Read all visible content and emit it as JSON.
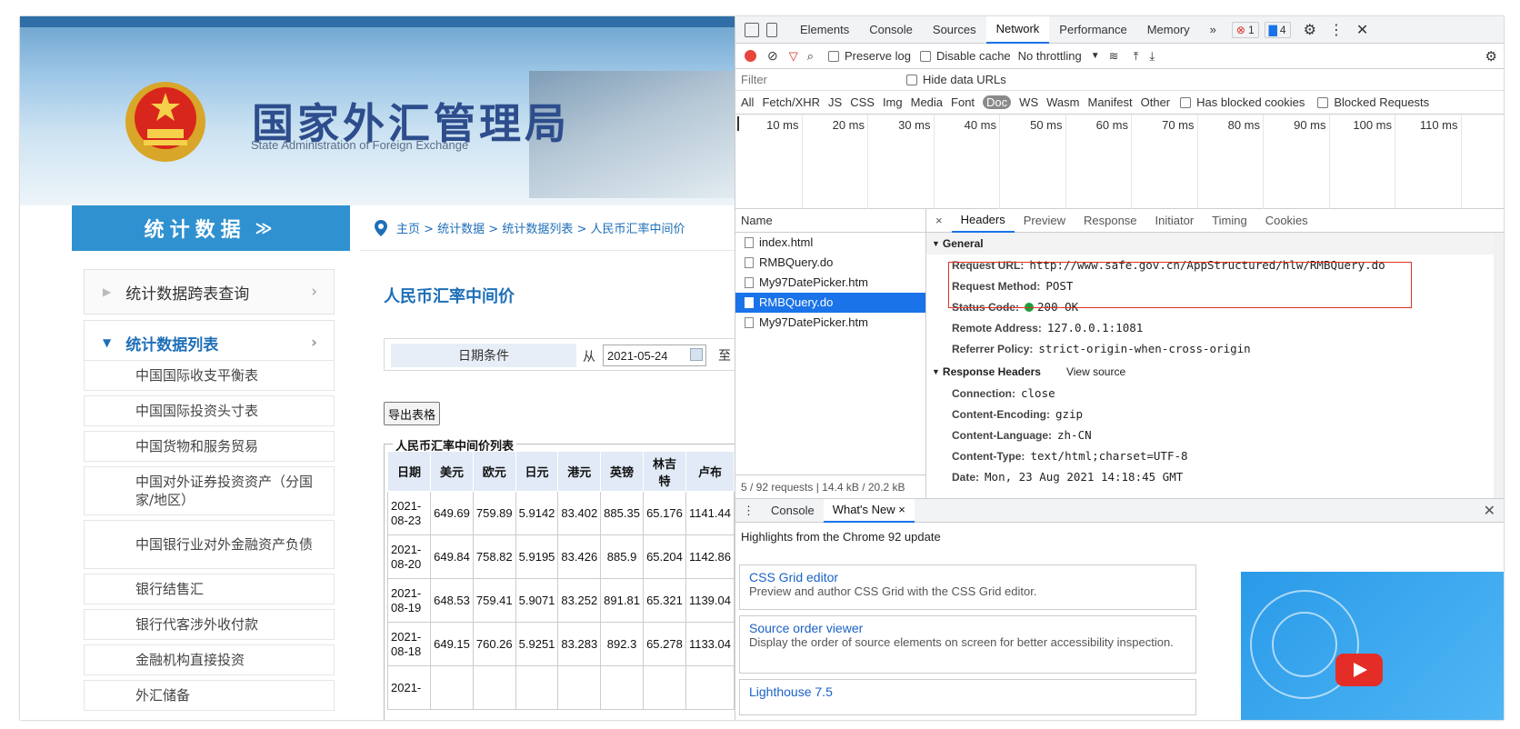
{
  "site": {
    "title": "国家外汇管理局",
    "subtitle": "State Administration of Foreign Exchange",
    "sidebar_heading": "统计数据",
    "sidebar_heading_chevron": "≫",
    "nav_items": [
      {
        "label": "统计数据跨表查询",
        "arrow": "›"
      },
      {
        "label": "统计数据列表",
        "arrow": "›"
      }
    ],
    "sub_items": [
      "中国国际收支平衡表",
      "中国国际投资头寸表",
      "中国货物和服务贸易",
      "中国对外证券投资资产（分国家/地区）",
      "中国银行业对外金融资产负债",
      "银行结售汇",
      "银行代客涉外收付款",
      "金融机构直接投资",
      "外汇储备"
    ],
    "breadcrumb": "主页 > 统计数据 > 统计数据列表 > 人民币汇率中间价",
    "page_heading": "人民币汇率中间价",
    "filter_label": "日期条件",
    "filter_from": "从",
    "filter_date": "2021-05-24",
    "filter_cut": "至",
    "export_button": "导出表格",
    "table_caption": "人民币汇率中间价列表",
    "table_headers": [
      "日期",
      "美元",
      "欧元",
      "日元",
      "港元",
      "英镑",
      "林吉特",
      "卢布"
    ],
    "rows": [
      [
        "2021-08-23",
        "649.69",
        "759.89",
        "5.9142",
        "83.402",
        "885.35",
        "65.176",
        "1141.44"
      ],
      [
        "2021-08-20",
        "649.84",
        "758.82",
        "5.9195",
        "83.426",
        "885.9",
        "65.204",
        "1142.86"
      ],
      [
        "2021-08-19",
        "648.53",
        "759.41",
        "5.9071",
        "83.252",
        "891.81",
        "65.321",
        "1139.04"
      ],
      [
        "2021-08-18",
        "649.15",
        "760.26",
        "5.9251",
        "83.283",
        "892.3",
        "65.278",
        "1133.04"
      ],
      [
        "2021-",
        "",
        "",
        "",
        "",
        "",
        "",
        ""
      ]
    ]
  },
  "devtools": {
    "tabs": [
      "Elements",
      "Console",
      "Sources",
      "Network",
      "Performance",
      "Memory",
      "»"
    ],
    "selected_tab": "Network",
    "error_count": "1",
    "message_count": "4",
    "toolbar": {
      "preserve_log": "Preserve log",
      "disable_cache": "Disable cache",
      "throttling": "No throttling"
    },
    "filter_placeholder": "Filter",
    "hide_data_urls": "Hide data URLs",
    "type_filters": [
      "All",
      "Fetch/XHR",
      "JS",
      "CSS",
      "Img",
      "Media",
      "Font",
      "Doc",
      "WS",
      "Wasm",
      "Manifest",
      "Other"
    ],
    "selected_type": "Doc",
    "has_blocked_cookies": "Has blocked cookies",
    "blocked_requests": "Blocked Requests",
    "timeline_ticks": [
      "10 ms",
      "20 ms",
      "30 ms",
      "40 ms",
      "50 ms",
      "60 ms",
      "70 ms",
      "80 ms",
      "90 ms",
      "100 ms",
      "110 ms"
    ],
    "name_header": "Name",
    "requests": [
      "index.html",
      "RMBQuery.do",
      "My97DatePicker.htm",
      "RMBQuery.do",
      "My97DatePicker.htm"
    ],
    "selected_request_index": 3,
    "footer": "5 / 92 requests  |  14.4 kB / 20.2 kB",
    "detail_tabs": [
      "×",
      "Headers",
      "Preview",
      "Response",
      "Initiator",
      "Timing",
      "Cookies"
    ],
    "general_title": "General",
    "general": [
      {
        "k": "Request URL:",
        "v": "http://www.safe.gov.cn/AppStructured/hlw/RMBQuery.do"
      },
      {
        "k": "Request Method:",
        "v": "POST"
      },
      {
        "k": "Status Code:",
        "v": "200 OK"
      },
      {
        "k": "Remote Address:",
        "v": "127.0.0.1:1081"
      },
      {
        "k": "Referrer Policy:",
        "v": "strict-origin-when-cross-origin"
      }
    ],
    "response_headers_title": "Response Headers",
    "view_source": "View source",
    "response_headers": [
      {
        "k": "Connection:",
        "v": "close"
      },
      {
        "k": "Content-Encoding:",
        "v": "gzip"
      },
      {
        "k": "Content-Language:",
        "v": "zh-CN"
      },
      {
        "k": "Content-Type:",
        "v": "text/html;charset=UTF-8"
      },
      {
        "k": "Date:",
        "v": "Mon, 23 Aug 2021 14:18:45 GMT"
      }
    ],
    "drawer_tabs": [
      "Console",
      "What's New ×"
    ],
    "drawer_highlight": "Highlights from the Chrome 92 update",
    "cards": [
      {
        "title": "CSS Grid editor",
        "desc": "Preview and author CSS Grid with the CSS Grid editor."
      },
      {
        "title": "Source order viewer",
        "desc": "Display the order of source elements on screen for better accessibility inspection."
      },
      {
        "title": "Lighthouse 7.5",
        "desc": ""
      }
    ]
  }
}
